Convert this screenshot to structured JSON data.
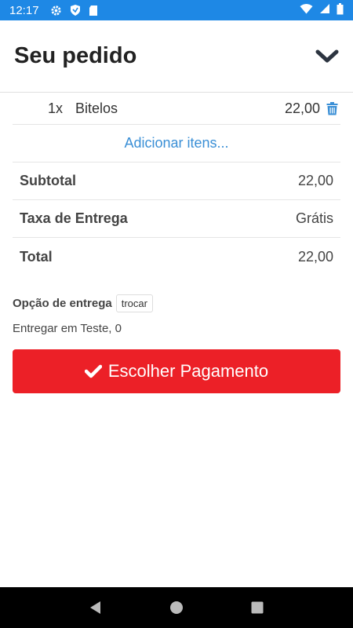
{
  "status_bar": {
    "time": "12:17",
    "icons": [
      "gear-icon",
      "shield-icon",
      "sd-card-icon",
      "wifi-icon",
      "battery-icon"
    ]
  },
  "header": {
    "title": "Seu pedido",
    "collapse_icon": "chevron-down-icon"
  },
  "items": [
    {
      "qty": "1x",
      "name": "Bitelos",
      "price": "22,00",
      "delete_icon": "trash-icon"
    }
  ],
  "add_items_label": "Adicionar itens...",
  "summary": {
    "subtotal_label": "Subtotal",
    "subtotal_value": "22,00",
    "fee_label": "Taxa de Entrega",
    "fee_value": "Grátis",
    "total_label": "Total",
    "total_value": "22,00"
  },
  "delivery": {
    "label": "Opção de entrega",
    "change_label": "trocar",
    "address": "Entregar em Teste, 0"
  },
  "pay_button": {
    "label": "Escolher Pagamento",
    "icon": "check-icon"
  },
  "colors": {
    "status_bar": "#1e88e5",
    "accent_link": "#3a8fd6",
    "pay_button": "#ec2027"
  },
  "nav_bar": {
    "icons": [
      "back-icon",
      "home-icon",
      "recents-icon"
    ]
  }
}
